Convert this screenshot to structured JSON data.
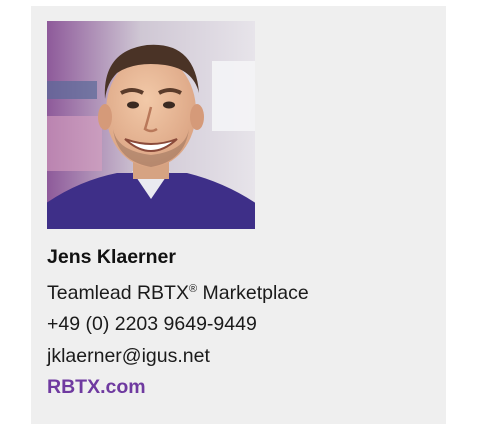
{
  "contact": {
    "name": "Jens Klaerner",
    "title_prefix": "Teamlead RBTX",
    "title_reg": "®",
    "title_suffix": " Marketplace",
    "phone": "+49 (0) 2203 9649-9449",
    "email": "jklaerner@igus.net",
    "website": "RBTX.com"
  },
  "colors": {
    "card_background": "#efefef",
    "link": "#6f3aa0",
    "text": "#1b1b1b"
  },
  "icons": {
    "photo": "portrait-photo"
  }
}
